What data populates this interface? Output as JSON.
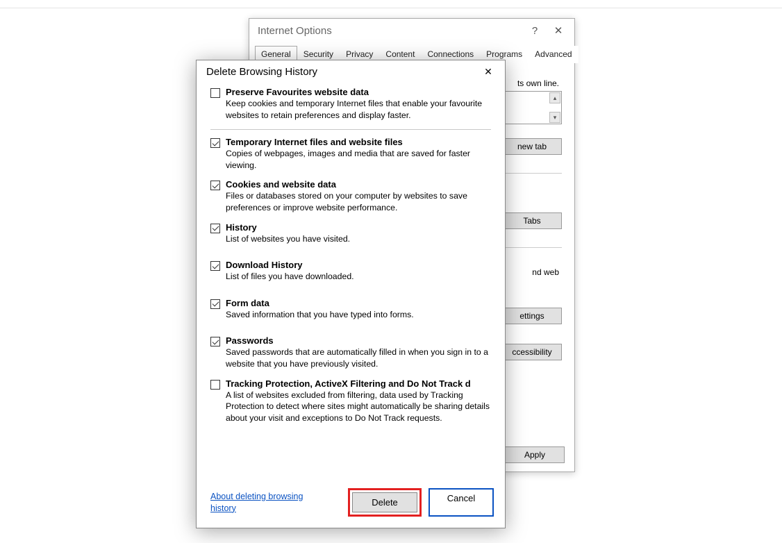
{
  "internet_options": {
    "title": "Internet Options",
    "help": "?",
    "close": "✕",
    "tabs": [
      "General",
      "Security",
      "Privacy",
      "Content",
      "Connections",
      "Programs",
      "Advanced"
    ],
    "active_tab": 0,
    "homepage_hint": "ts own line.",
    "buttons": {
      "new_tab": "new tab",
      "tabs": "Tabs",
      "and_web": "nd web",
      "settings": "ettings",
      "accessibility": "ccessibility",
      "apply": "Apply"
    }
  },
  "dbh": {
    "title": "Delete Browsing History",
    "close": "✕",
    "items": [
      {
        "checked": false,
        "label": "Preserve Favourites website data",
        "desc": "Keep cookies and temporary Internet files that enable your favourite websites to retain preferences and display faster."
      },
      {
        "checked": true,
        "label": "Temporary Internet files and website files",
        "desc": "Copies of webpages, images and media that are saved for faster viewing."
      },
      {
        "checked": true,
        "label": "Cookies and website data",
        "desc": "Files or databases stored on your computer by websites to save preferences or improve website performance."
      },
      {
        "checked": true,
        "label": "History",
        "desc": "List of websites you have visited."
      },
      {
        "checked": true,
        "label": "Download History",
        "desc": "List of files you have downloaded."
      },
      {
        "checked": true,
        "label": "Form data",
        "desc": "Saved information that you have typed into forms."
      },
      {
        "checked": true,
        "label": "Passwords",
        "desc": "Saved passwords that are automatically filled in when you sign in to a website that you have previously visited."
      },
      {
        "checked": false,
        "label": "Tracking Protection, ActiveX Filtering and Do Not Track d",
        "desc": "A list of websites excluded from filtering, data used by Tracking Protection to detect where sites might automatically be sharing details about your visit and exceptions to Do Not Track requests."
      }
    ],
    "link": "About deleting browsing history",
    "delete": "Delete",
    "cancel": "Cancel"
  }
}
